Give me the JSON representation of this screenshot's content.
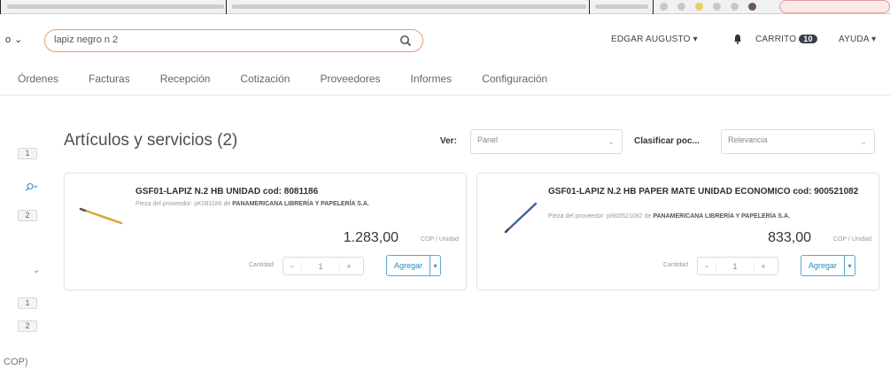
{
  "header": {
    "scope_label": "lapiz negro n 2",
    "scope_select": "o",
    "search_value": "lapiz negro n 2",
    "user_name": "EDGAR AUGUSTO",
    "cart_label": "CARRITO",
    "cart_count": "10",
    "help_label": "AYUDA"
  },
  "nav": {
    "items": [
      "Órdenes",
      "Facturas",
      "Recepción",
      "Cotización",
      "Proveedores",
      "Informes",
      "Configuración"
    ]
  },
  "left": {
    "chips": [
      "1",
      "2",
      "1",
      "2"
    ],
    "currency": "COP)"
  },
  "results": {
    "title": "Artículos y servicios (2)",
    "view_label": "Ver:",
    "view_value": "Panel",
    "sort_label": "Clasificar poc...",
    "sort_value": "Relevancia"
  },
  "products": [
    {
      "title": "GSF01-LAPIZ N.2 HB UNIDAD cod: 8081186",
      "subtitle_prefix": "Pieza del proveedor: pK081186 de",
      "supplier": "PANAMERICANA LIBRERÍA Y PAPELERÍA S.A.",
      "price": "1.283,00",
      "unit": "COP / Unidad",
      "qty_label": "Cantidad",
      "qty": "1",
      "add_label": "Agregar"
    },
    {
      "title": "GSF01-LAPIZ N.2 HB PAPER MATE UNIDAD ECONOMICO cod: 900521082",
      "subtitle_prefix": "Pieza del proveedor: pi900521082 de",
      "supplier": "PANAMERICANA LIBRERÍA Y PAPELERÍA S.A.",
      "price": "833,00",
      "unit": "COP / Unidad",
      "qty_label": "Cantidad",
      "qty": "1",
      "add_label": "Agregar"
    }
  ],
  "colors": {
    "search_border": "#ee9c6d",
    "accent_blue": "#2d8bc7",
    "badge_bg": "#3a3f47"
  }
}
